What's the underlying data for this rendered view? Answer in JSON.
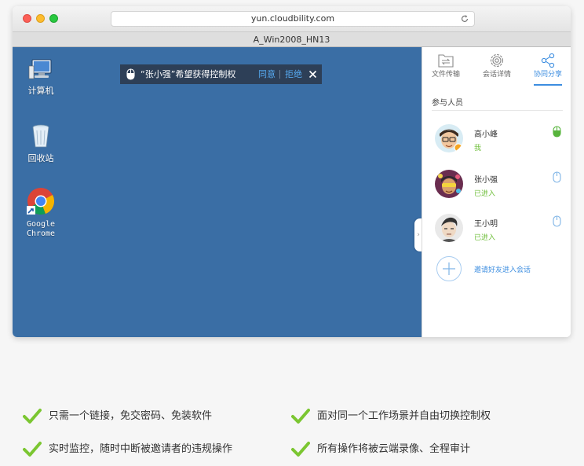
{
  "browser": {
    "url": "yun.cloudbility.com",
    "tab_title": "A_Win2008_HN13"
  },
  "desktop": {
    "icons": [
      {
        "label": "计算机",
        "icon": "computer-icon"
      },
      {
        "label": "回收站",
        "icon": "recycle-bin-icon"
      },
      {
        "label_line1": "Google",
        "label_line2": "Chrome",
        "icon": "chrome-icon"
      }
    ]
  },
  "control_request": {
    "message": "“张小强”希望获得控制权",
    "agree": "同意",
    "reject": "拒绝"
  },
  "panel": {
    "tabs": [
      {
        "label": "文件传输",
        "icon": "file-transfer-icon"
      },
      {
        "label": "会话详情",
        "icon": "gear-icon"
      },
      {
        "label": "协同分享",
        "icon": "share-icon",
        "active": true
      }
    ],
    "section_title": "参与人员",
    "participants": [
      {
        "name": "高小峰",
        "status": "我",
        "control": "active"
      },
      {
        "name": "张小强",
        "status": "已进入",
        "control": "inactive"
      },
      {
        "name": "王小明",
        "status": "已进入",
        "control": "inactive"
      }
    ],
    "invite_label": "邀请好友进入会话"
  },
  "features": [
    "只需一个链接，免交密码、免装软件",
    "面对同一个工作场景并自由切换控制权",
    "实时监控，随时中断被邀请者的违规操作",
    "所有操作将被云端录像、全程审计"
  ],
  "colors": {
    "desktop_bg": "#3a6ea5",
    "accent": "#3d8ee0",
    "status_green": "#6fbf3b",
    "check_green": "#7bc631"
  }
}
